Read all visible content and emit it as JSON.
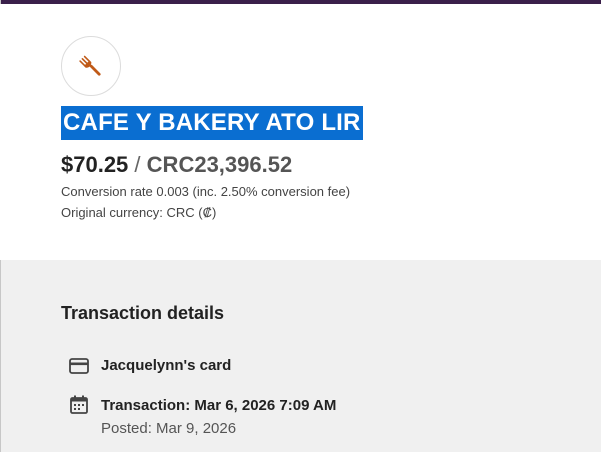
{
  "colors": {
    "top_bar": "#3a1f4a",
    "highlight": "#0a6ed1",
    "icon_accent": "#c05a18",
    "details_background": "#f0f0f0"
  },
  "merchant": {
    "icon": "fork-icon",
    "name": "CAFE Y BAKERY ATO LIR"
  },
  "amount": {
    "usd": "$70.25",
    "separator": "/",
    "original": "CRC23,396.52"
  },
  "conversion_rate": "Conversion rate 0.003 (inc. 2.50% conversion fee)",
  "original_currency": "Original currency: CRC (₡)",
  "details": {
    "title": "Transaction details",
    "card_icon": "credit-card-icon",
    "card_label": "Jacquelynn's card",
    "calendar_icon": "calendar-icon",
    "transaction_date": "Transaction: Mar 6, 2026 7:09 AM",
    "posted_date": "Posted: Mar 9, 2026"
  }
}
